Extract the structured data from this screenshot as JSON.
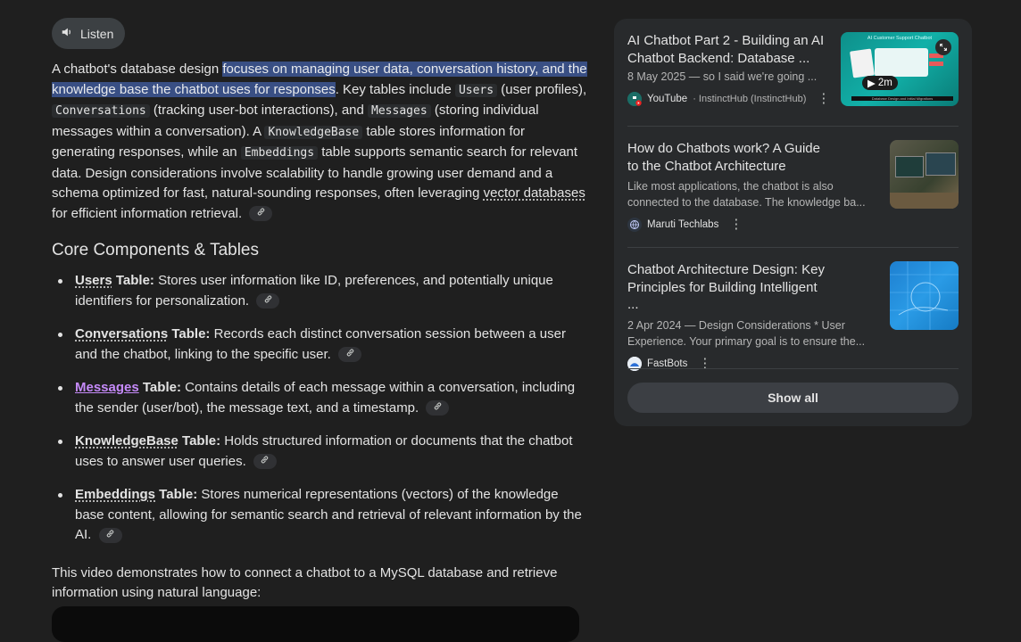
{
  "listen": {
    "label": "Listen"
  },
  "intro": {
    "p1": "A chatbot's database design ",
    "highlight": "focuses on managing user data, conversation history, and the knowledge base the chatbot uses for responses",
    "p2": ". Key tables include ",
    "users_code": "Users",
    "p3": " (user profiles), ",
    "conversations_code": "Conversations",
    "p4": " (tracking user-bot interactions), and ",
    "messages_code": "Messages",
    "p5": " (storing individual messages within a conversation). A ",
    "kb_code": "KnowledgeBase",
    "p6": " table stores information for generating responses, while an ",
    "emb_code": "Embeddings",
    "p7": " table supports semantic search for relevant data. Design considerations involve scalability to handle growing user demand and a schema optimized for fast, natural-sounding responses, often leveraging ",
    "link_text": "vector databases",
    "p8": " for efficient information retrieval."
  },
  "section": {
    "heading": "Core Components & Tables",
    "items": [
      {
        "name": "Users",
        "suffix": " Table:",
        "text": " Stores user information like ID, preferences, and potentially unique identifiers for personalization."
      },
      {
        "name": "Conversations",
        "suffix": " Table:",
        "text": " Records each distinct conversation session between a user and the chatbot, linking to the specific user."
      },
      {
        "name": "Messages",
        "suffix": " Table:",
        "text": " Contains details of each message within a conversation, including the sender (user/bot), the message text, and a timestamp."
      },
      {
        "name": "KnowledgeBase",
        "suffix": " Table:",
        "text": " Holds structured information or documents that the chatbot uses to answer user queries."
      },
      {
        "name": "Embeddings",
        "suffix": " Table:",
        "text": " Stores numerical representations (vectors) of the knowledge base content, allowing for semantic search and retrieval of relevant information by the AI."
      }
    ]
  },
  "video_text": "This video demonstrates how to connect a chatbot to a MySQL database and retrieve information using natural language:",
  "sources": {
    "items": [
      {
        "title": "AI Chatbot Part 2 - Building an AI Chatbot Backend: Database ...",
        "snippet": "8 May 2025 — so I said we're going ...",
        "source": "YouTube",
        "sub": "· InstinctHub (InstinctHub)",
        "duration": "2m",
        "thumb_title": "AI Customer Support Chatbot",
        "thumb_caption": "Database Design and Initial Migrations"
      },
      {
        "title": "How do Chatbots work? A Guide to the Chatbot Architecture",
        "snippet": "Like most applications, the chatbot is also connected to the database. The knowledge ba...",
        "source": "Maruti Techlabs"
      },
      {
        "title": "Chatbot Architecture Design: Key Principles for Building Intelligent ...",
        "snippet": "2 Apr 2024 — Design Considerations * User Experience. Your primary goal is to ensure the...",
        "source": "FastBots"
      }
    ],
    "show_all": "Show all"
  },
  "colors": {
    "background": "#1f1f1f",
    "panel": "#282a2c",
    "highlight": "#394f84",
    "link_purple": "#c58af9"
  }
}
